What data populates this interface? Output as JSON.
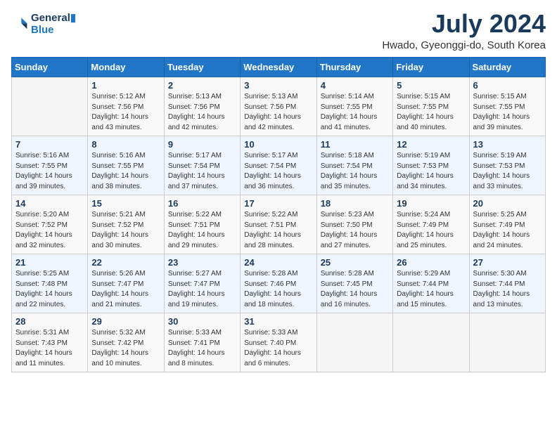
{
  "logo": {
    "line1": "General",
    "line2": "Blue"
  },
  "title": "July 2024",
  "location": "Hwado, Gyeonggi-do, South Korea",
  "weekdays": [
    "Sunday",
    "Monday",
    "Tuesday",
    "Wednesday",
    "Thursday",
    "Friday",
    "Saturday"
  ],
  "weeks": [
    [
      {
        "day": "",
        "info": ""
      },
      {
        "day": "1",
        "info": "Sunrise: 5:12 AM\nSunset: 7:56 PM\nDaylight: 14 hours\nand 43 minutes."
      },
      {
        "day": "2",
        "info": "Sunrise: 5:13 AM\nSunset: 7:56 PM\nDaylight: 14 hours\nand 42 minutes."
      },
      {
        "day": "3",
        "info": "Sunrise: 5:13 AM\nSunset: 7:56 PM\nDaylight: 14 hours\nand 42 minutes."
      },
      {
        "day": "4",
        "info": "Sunrise: 5:14 AM\nSunset: 7:55 PM\nDaylight: 14 hours\nand 41 minutes."
      },
      {
        "day": "5",
        "info": "Sunrise: 5:15 AM\nSunset: 7:55 PM\nDaylight: 14 hours\nand 40 minutes."
      },
      {
        "day": "6",
        "info": "Sunrise: 5:15 AM\nSunset: 7:55 PM\nDaylight: 14 hours\nand 39 minutes."
      }
    ],
    [
      {
        "day": "7",
        "info": "Sunrise: 5:16 AM\nSunset: 7:55 PM\nDaylight: 14 hours\nand 39 minutes."
      },
      {
        "day": "8",
        "info": "Sunrise: 5:16 AM\nSunset: 7:55 PM\nDaylight: 14 hours\nand 38 minutes."
      },
      {
        "day": "9",
        "info": "Sunrise: 5:17 AM\nSunset: 7:54 PM\nDaylight: 14 hours\nand 37 minutes."
      },
      {
        "day": "10",
        "info": "Sunrise: 5:17 AM\nSunset: 7:54 PM\nDaylight: 14 hours\nand 36 minutes."
      },
      {
        "day": "11",
        "info": "Sunrise: 5:18 AM\nSunset: 7:54 PM\nDaylight: 14 hours\nand 35 minutes."
      },
      {
        "day": "12",
        "info": "Sunrise: 5:19 AM\nSunset: 7:53 PM\nDaylight: 14 hours\nand 34 minutes."
      },
      {
        "day": "13",
        "info": "Sunrise: 5:19 AM\nSunset: 7:53 PM\nDaylight: 14 hours\nand 33 minutes."
      }
    ],
    [
      {
        "day": "14",
        "info": "Sunrise: 5:20 AM\nSunset: 7:52 PM\nDaylight: 14 hours\nand 32 minutes."
      },
      {
        "day": "15",
        "info": "Sunrise: 5:21 AM\nSunset: 7:52 PM\nDaylight: 14 hours\nand 30 minutes."
      },
      {
        "day": "16",
        "info": "Sunrise: 5:22 AM\nSunset: 7:51 PM\nDaylight: 14 hours\nand 29 minutes."
      },
      {
        "day": "17",
        "info": "Sunrise: 5:22 AM\nSunset: 7:51 PM\nDaylight: 14 hours\nand 28 minutes."
      },
      {
        "day": "18",
        "info": "Sunrise: 5:23 AM\nSunset: 7:50 PM\nDaylight: 14 hours\nand 27 minutes."
      },
      {
        "day": "19",
        "info": "Sunrise: 5:24 AM\nSunset: 7:49 PM\nDaylight: 14 hours\nand 25 minutes."
      },
      {
        "day": "20",
        "info": "Sunrise: 5:25 AM\nSunset: 7:49 PM\nDaylight: 14 hours\nand 24 minutes."
      }
    ],
    [
      {
        "day": "21",
        "info": "Sunrise: 5:25 AM\nSunset: 7:48 PM\nDaylight: 14 hours\nand 22 minutes."
      },
      {
        "day": "22",
        "info": "Sunrise: 5:26 AM\nSunset: 7:47 PM\nDaylight: 14 hours\nand 21 minutes."
      },
      {
        "day": "23",
        "info": "Sunrise: 5:27 AM\nSunset: 7:47 PM\nDaylight: 14 hours\nand 19 minutes."
      },
      {
        "day": "24",
        "info": "Sunrise: 5:28 AM\nSunset: 7:46 PM\nDaylight: 14 hours\nand 18 minutes."
      },
      {
        "day": "25",
        "info": "Sunrise: 5:28 AM\nSunset: 7:45 PM\nDaylight: 14 hours\nand 16 minutes."
      },
      {
        "day": "26",
        "info": "Sunrise: 5:29 AM\nSunset: 7:44 PM\nDaylight: 14 hours\nand 15 minutes."
      },
      {
        "day": "27",
        "info": "Sunrise: 5:30 AM\nSunset: 7:44 PM\nDaylight: 14 hours\nand 13 minutes."
      }
    ],
    [
      {
        "day": "28",
        "info": "Sunrise: 5:31 AM\nSunset: 7:43 PM\nDaylight: 14 hours\nand 11 minutes."
      },
      {
        "day": "29",
        "info": "Sunrise: 5:32 AM\nSunset: 7:42 PM\nDaylight: 14 hours\nand 10 minutes."
      },
      {
        "day": "30",
        "info": "Sunrise: 5:33 AM\nSunset: 7:41 PM\nDaylight: 14 hours\nand 8 minutes."
      },
      {
        "day": "31",
        "info": "Sunrise: 5:33 AM\nSunset: 7:40 PM\nDaylight: 14 hours\nand 6 minutes."
      },
      {
        "day": "",
        "info": ""
      },
      {
        "day": "",
        "info": ""
      },
      {
        "day": "",
        "info": ""
      }
    ]
  ]
}
